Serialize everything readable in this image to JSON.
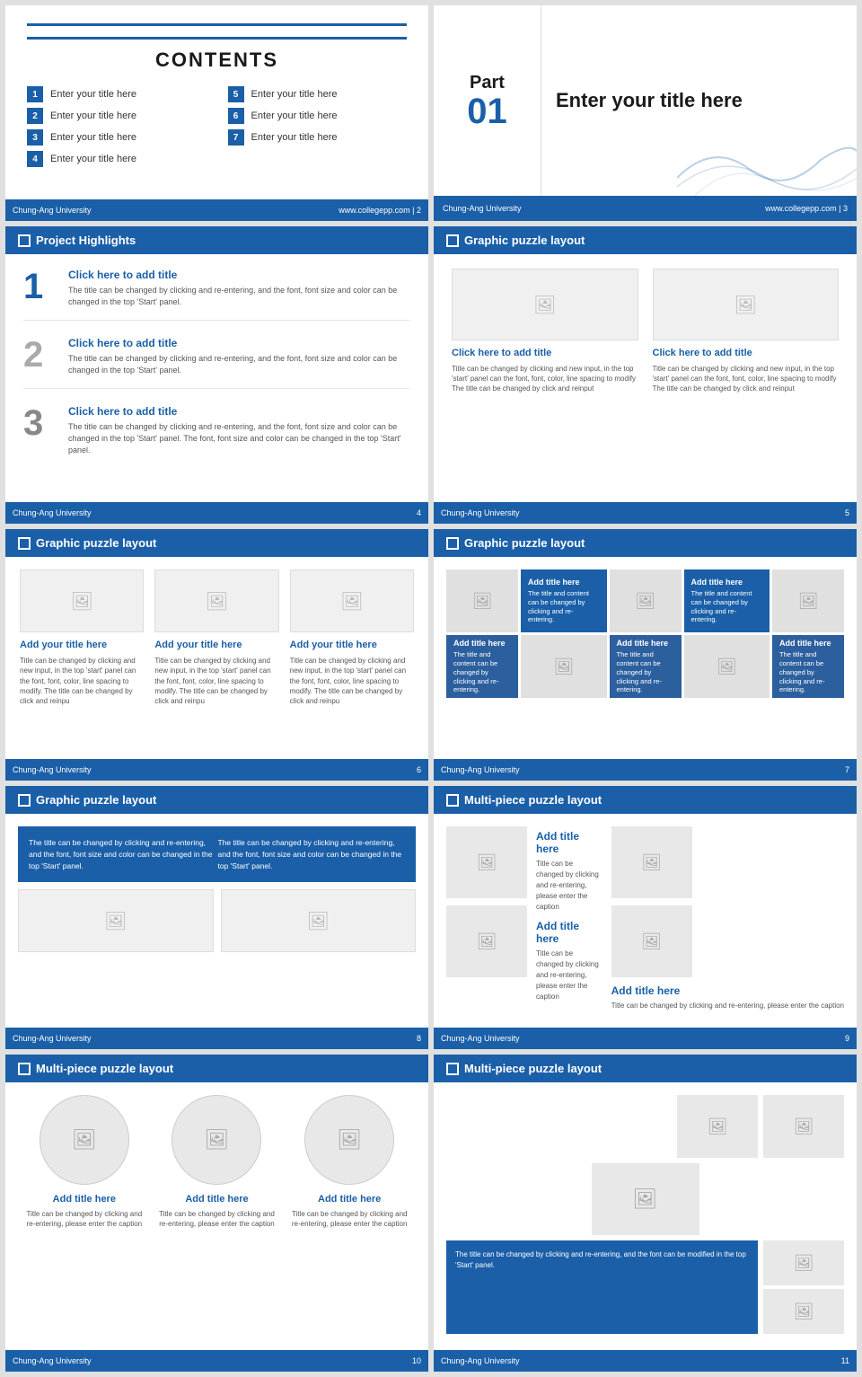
{
  "slides": {
    "contents": {
      "title": "CONTENTS",
      "items": [
        {
          "num": "1",
          "text": "Enter your title here"
        },
        {
          "num": "5",
          "text": "Enter your title here"
        },
        {
          "num": "2",
          "text": "Enter your title here"
        },
        {
          "num": "6",
          "text": "Enter your title here"
        },
        {
          "num": "3",
          "text": "Enter your title here"
        },
        {
          "num": "7",
          "text": "Enter your title here"
        },
        {
          "num": "4",
          "text": "Enter your title here"
        }
      ],
      "footer_left": "Chung-Ang University",
      "footer_right": "www.collegepp.com | 2"
    },
    "part": {
      "label": "Part",
      "number": "01",
      "title": "Enter your title here",
      "footer_left": "Chung-Ang University",
      "footer_right": "www.collegepp.com | 3"
    },
    "project_highlights": {
      "header": "Project Highlights",
      "items": [
        {
          "num": "1",
          "title": "Click here to add title",
          "text": "The title can be changed by clicking and re-entering, and the font, font size and color can be changed in the top 'Start' panel."
        },
        {
          "num": "2",
          "title": "Click here to add title",
          "text": "The title can be changed by clicking and re-entering, and the font, font size and color can be changed in the top 'Start' panel."
        },
        {
          "num": "3",
          "title": "Click here to add title",
          "text": "The title can be changed by clicking and re-entering, and the font, font size and color can be changed in the top 'Start' panel. The font, font size and color can be changed in the top 'Start' panel."
        }
      ],
      "footer_left": "Chung-Ang University",
      "footer_right": "4"
    },
    "graphic2": {
      "header": "Graphic puzzle layout",
      "cards": [
        {
          "title": "Click here to add title",
          "text": "Title can be changed by clicking and new input, in the top 'start' panel can the font, font, color, line spacing to modify The title can be changed by click and reinput"
        },
        {
          "title": "Click here to add title",
          "text": "Title can be changed by clicking and new input, in the top 'start' panel can the font, font, color, line spacing to modify The title can be changed by click and reinput"
        }
      ],
      "footer_right": "5"
    },
    "graphic3a": {
      "header": "Graphic puzzle layout",
      "cards": [
        {
          "title": "Add your title here",
          "text": "Title can be changed by clicking and new input, in the top 'start' panel can the font, font, color, line spacing to modify. The title can be changed by click and reinpu"
        },
        {
          "title": "Add your title here",
          "text": "Title can be changed by clicking and new input, in the top 'start' panel can the font, font, color, line spacing to modify. The title can be changed by click and reinpu"
        },
        {
          "title": "Add your title here",
          "text": "Title can be changed by clicking and new input, in the top 'start' panel can the font, font, color, line spacing to modify. The title can be changed by click and reinpu"
        }
      ],
      "footer_right": "6"
    },
    "graphic3b": {
      "header": "Graphic puzzle layout",
      "puzzle_rows": [
        {
          "cells": [
            {
              "type": "img"
            },
            {
              "type": "text",
              "title": "Add title here",
              "text": "The title and content can be changed by clicking and re-entering."
            },
            {
              "type": "img"
            },
            {
              "type": "text",
              "title": "Add title here",
              "text": "The title and content can be changed by clicking and re-entering."
            },
            {
              "type": "img"
            }
          ]
        },
        {
          "cells": [
            {
              "type": "text-dark",
              "title": "Add title here",
              "text": "The title and content can be changed by clicking and re-entering."
            },
            {
              "type": "img"
            },
            {
              "type": "text-dark",
              "title": "Add title here",
              "text": "The title and content can be changed by clicking and re-entering."
            },
            {
              "type": "img"
            },
            {
              "type": "text-dark",
              "title": "Add title here",
              "text": "The title and content can be changed by clicking and re-entering."
            }
          ]
        }
      ],
      "footer_right": "7"
    },
    "graphic8": {
      "header": "Graphic puzzle layout",
      "top_texts": [
        "The title can be changed by clicking and re-entering, and the font, font size and color can be changed in the top 'Start' panel.",
        "The title can be changed by clicking and re-entering, and the font, font size and color can be changed in the top 'Start' panel."
      ],
      "footer_right": "8"
    },
    "multi9": {
      "header": "Multi-piece puzzle layout",
      "sections": [
        {
          "title": "Add title here",
          "text": "Title can be changed by clicking and re-entering, please enter the caption"
        },
        {
          "title": "Add title here",
          "text": "Title can be changed by clicking and re-entering, please enter the caption"
        },
        {
          "title": "Add title here",
          "text": "Title can be changed by clicking and re-entering, please enter the caption"
        }
      ],
      "footer_right": "9"
    },
    "circles10": {
      "header": "Multi-piece puzzle layout",
      "cards": [
        {
          "title": "Add title here",
          "text": "Title can be changed by clicking and re-entering, please enter the caption"
        },
        {
          "title": "Add title here",
          "text": "Title can be changed by clicking and re-entering, please enter the caption"
        },
        {
          "title": "Add title here",
          "text": "Title can be changed by clicking and re-entering, please enter the caption"
        }
      ],
      "footer_right": "10"
    },
    "mosaic11": {
      "header": "Multi-piece puzzle layout",
      "bottom_text": "The title can be changed by clicking and re-entering, and the font can be modified in the top 'Start' panel.",
      "footer_right": "11"
    }
  },
  "footer": {
    "left": "Chung-Ang University",
    "site": "www.collegepp.com"
  },
  "colors": {
    "primary": "#1a5fa8",
    "light_gray": "#f0f0f0",
    "text_dark": "#1a1a1a",
    "text_body": "#555"
  },
  "icons": {
    "image": "🖼",
    "checkbox": "□"
  }
}
